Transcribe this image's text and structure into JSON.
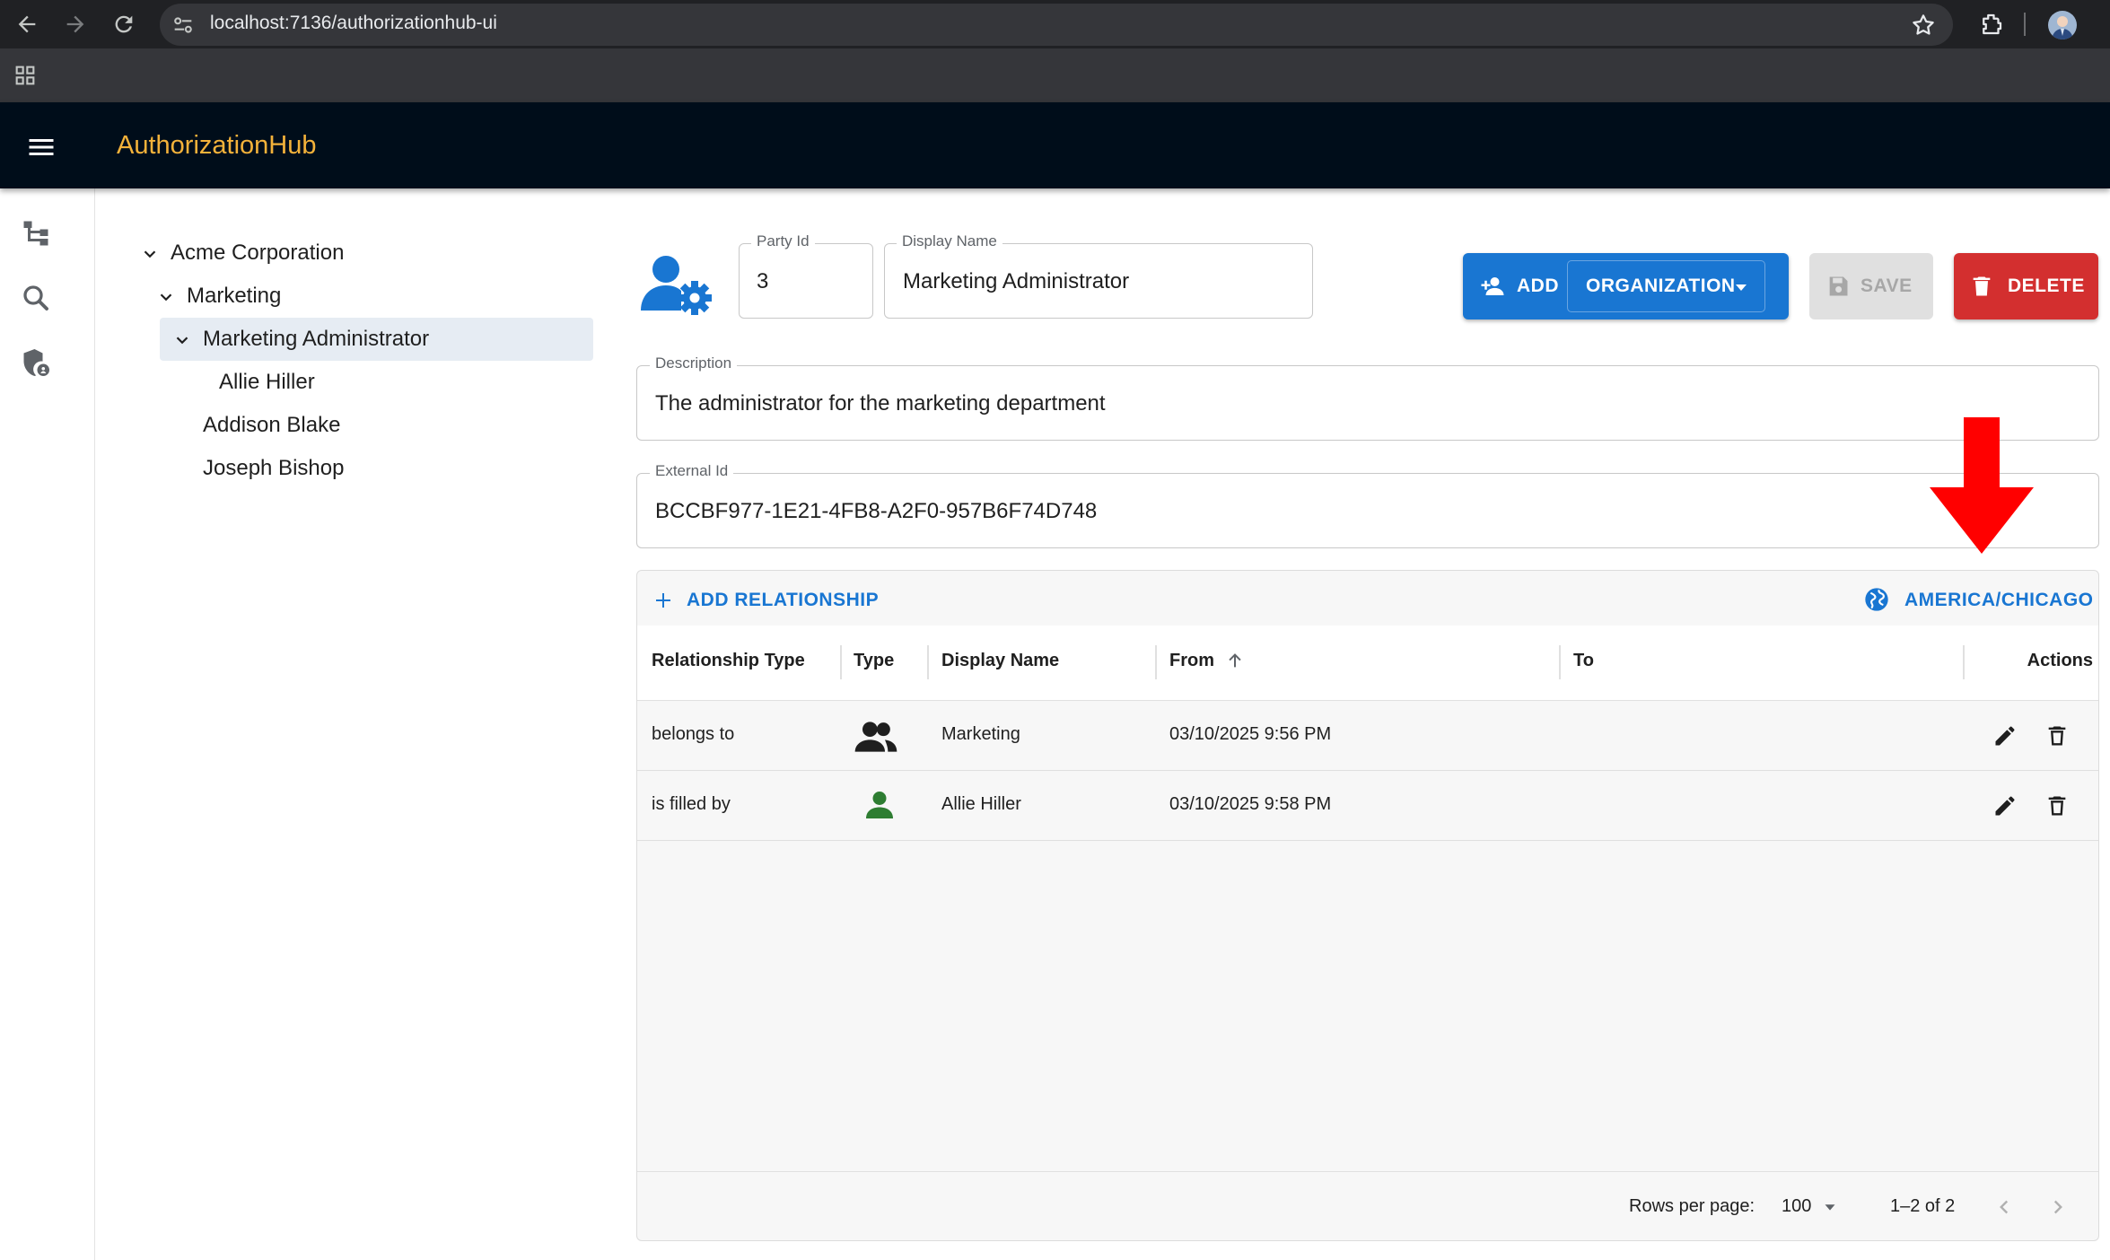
{
  "browser": {
    "url": "localhost:7136/authorizationhub-ui"
  },
  "app": {
    "title": "AuthorizationHub"
  },
  "tree": {
    "items": [
      {
        "label": "Acme Corporation"
      },
      {
        "label": "Marketing"
      },
      {
        "label": "Marketing Administrator"
      },
      {
        "label": "Allie Hiller"
      },
      {
        "label": "Addison Blake"
      },
      {
        "label": "Joseph Bishop"
      }
    ]
  },
  "form": {
    "party_id_label": "Party Id",
    "party_id_value": "3",
    "display_name_label": "Display Name",
    "display_name_value": "Marketing Administrator",
    "description_label": "Description",
    "description_value": "The administrator for the marketing department",
    "external_id_label": "External Id",
    "external_id_value": "BCCBF977-1E21-4FB8-A2F0-957B6F74D748"
  },
  "toolbar": {
    "add_label": "ADD",
    "organization_label": "ORGANIZATION",
    "save_label": "SAVE",
    "delete_label": "DELETE"
  },
  "grid": {
    "add_relationship_label": "ADD RELATIONSHIP",
    "timezone_label": "AMERICA/CHICAGO",
    "columns": [
      "Relationship Type",
      "Type",
      "Display Name",
      "From",
      "To",
      "Actions"
    ],
    "rows": [
      {
        "relationship_type": "belongs to",
        "type_icon": "group-icon",
        "display_name": "Marketing",
        "from": "03/10/2025 9:56 PM",
        "to": ""
      },
      {
        "relationship_type": "is filled by",
        "type_icon": "person-icon",
        "display_name": "Allie Hiller",
        "from": "03/10/2025 9:58 PM",
        "to": ""
      }
    ],
    "rows_per_page_label": "Rows per page:",
    "rows_per_page_value": "100",
    "pagination_text": "1–2 of 2"
  },
  "colors": {
    "primary": "#1976d2",
    "danger": "#d32f2f",
    "appbar": "#000d1a",
    "title": "#f4b23a",
    "annotation_arrow": "#ff0000",
    "person_icon": "#2e7d32"
  }
}
